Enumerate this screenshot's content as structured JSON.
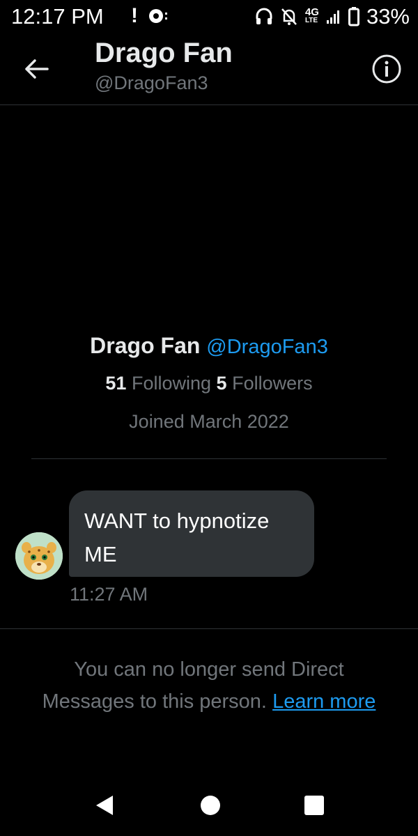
{
  "status_bar": {
    "time": "12:17 PM",
    "alert": "!",
    "network": "4G",
    "network_sub": "LTE",
    "battery": "33%",
    "icons": [
      "alert-icon",
      "record-icon",
      "headphones-icon",
      "mute-bell-icon",
      "signal-icon",
      "battery-icon"
    ]
  },
  "header": {
    "title": "Drago Fan",
    "handle": "@DragoFan3",
    "back_icon": "arrow-left-icon",
    "info_icon": "info-icon"
  },
  "profile": {
    "name": "Drago Fan",
    "handle": "@DragoFan3",
    "following_count": "51",
    "following_label": "Following",
    "followers_count": "5",
    "followers_label": "Followers",
    "joined": "Joined March 2022"
  },
  "message": {
    "text": "WANT to hypnotize ME",
    "time": "11:27 AM"
  },
  "notice": {
    "text": "You can no longer send Direct Messages to this person.",
    "link": "Learn more"
  },
  "colors": {
    "background": "#000000",
    "accent": "#1d9bf0",
    "muted": "#71767b",
    "bubble": "#2f3336"
  },
  "nav_icons": [
    "nav-back-icon",
    "nav-home-icon",
    "nav-recents-icon"
  ]
}
